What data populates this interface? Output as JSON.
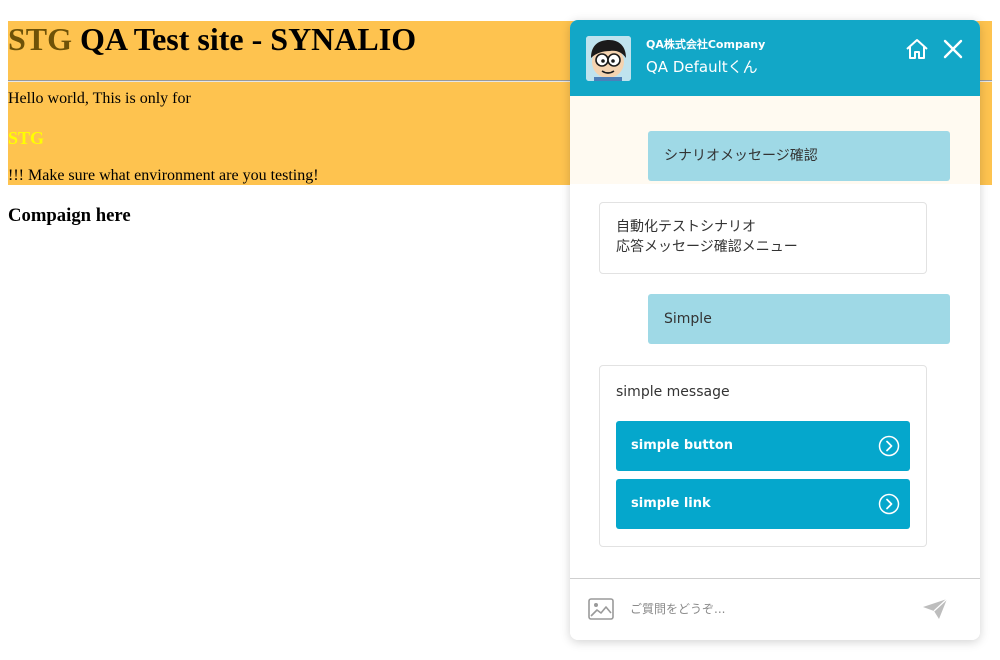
{
  "page": {
    "title_env": "STG",
    "title_rest": " QA Test site - SYNALIO",
    "hello": "Hello world, This is only for",
    "env_tag": "STG",
    "warning": "!!! Make sure what environment are you testing!",
    "campaign": "Compaign here"
  },
  "chat": {
    "company": "QA株式会社Company",
    "bot_name": "QA Defaultくん",
    "messages": {
      "user_1": "シナリオメッセージ確認",
      "bot_1_line1": "自動化テストシナリオ",
      "bot_1_line2": "応答メッセージ確認メニュー",
      "user_2": "Simple",
      "bot_2": "simple message",
      "button_1": "simple button",
      "button_2": "simple link"
    },
    "input_placeholder": "ご質問をどうぞ...",
    "icons": {
      "home": "home-icon",
      "close": "close-icon",
      "image": "image-icon",
      "send": "send-icon",
      "chevron": "chevron-right-circle-icon"
    },
    "colors": {
      "header": "#12a7c7",
      "user_bubble": "#9fd9e6",
      "button": "#05a7cc"
    }
  },
  "colors": {
    "banner": "#fec34f",
    "env_title": "#6e5208",
    "env_tag": "#ffff00"
  }
}
